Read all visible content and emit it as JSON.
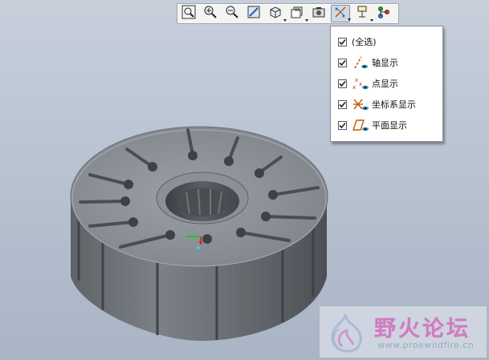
{
  "toolbar": {
    "buttons": [
      {
        "icon": "zoom-fit-icon"
      },
      {
        "icon": "zoom-in-icon"
      },
      {
        "icon": "zoom-out-icon"
      },
      {
        "icon": "repaint-icon"
      },
      {
        "icon": "view-orientation-icon"
      },
      {
        "icon": "saved-views-icon"
      },
      {
        "icon": "display-style-icon"
      },
      {
        "icon": "datum-display-icon",
        "active": true
      },
      {
        "icon": "annotation-display-icon"
      },
      {
        "icon": "spin-center-icon"
      }
    ]
  },
  "dropdown": {
    "items": [
      {
        "label": "(全选)",
        "checked": true,
        "icon": ""
      },
      {
        "label": "轴显示",
        "checked": true,
        "icon": "axis-display-icon"
      },
      {
        "label": "点显示",
        "checked": true,
        "icon": "point-display-icon"
      },
      {
        "label": "坐标系显示",
        "checked": true,
        "icon": "csys-display-icon"
      },
      {
        "label": "平面显示",
        "checked": true,
        "icon": "plane-display-icon"
      }
    ]
  },
  "watermark": {
    "title": "野火论坛",
    "url": "www.proewildfire.cn"
  },
  "colors": {
    "background": "#b6c0cf",
    "model": "#7e8389",
    "menu_bg": "#ffffff",
    "watermark_title": "#d27bc0"
  }
}
